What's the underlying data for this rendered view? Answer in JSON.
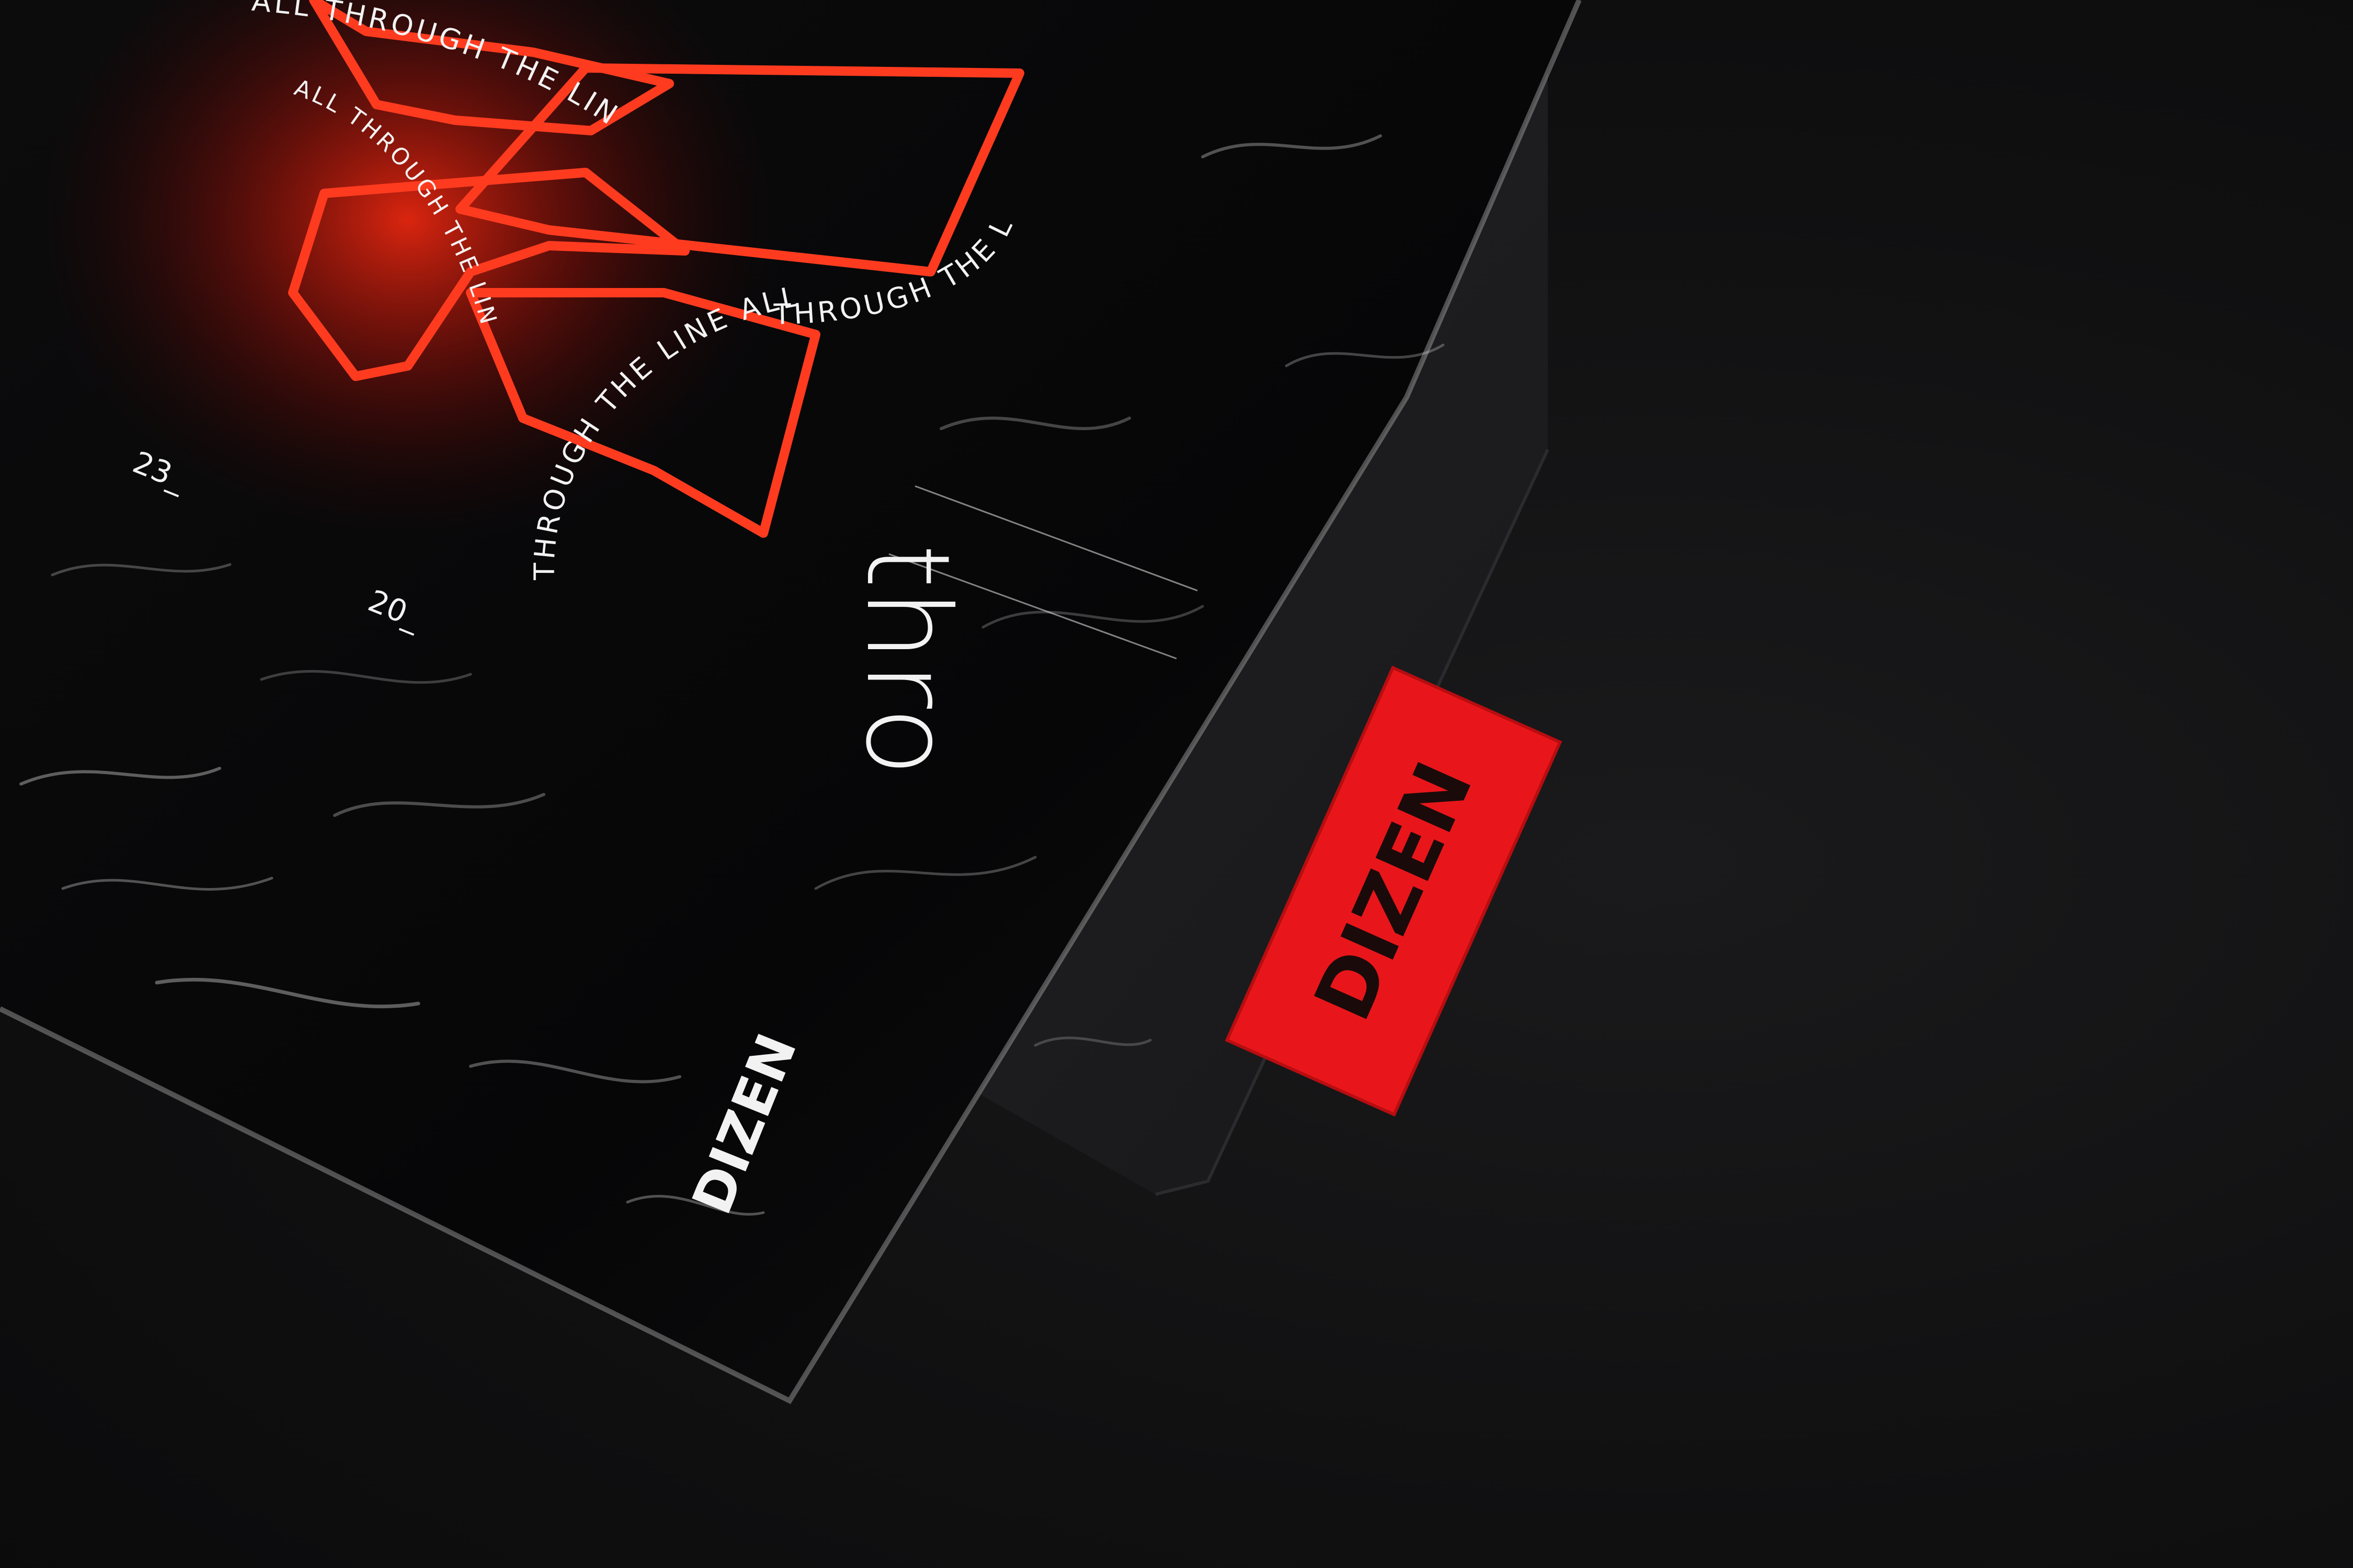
{
  "scene": {
    "description_label": "",
    "colors": {
      "background": "#101011",
      "fabric": "#1e1e20",
      "neon": "#ff3b1f",
      "label_red": "#e8161a",
      "text_white": "#f2f2f2"
    }
  },
  "bag": {
    "circular_text_outer": "ALL THROUGH THE LINE",
    "circular_text_inner": "THROUGH THE LINE ALL",
    "circular_text_spiral": "THROUGH THE LINE ALL THROUGH THE LINE ALL",
    "circular_text_small": "ALL THROUGH THE LINE ALL THROUGH",
    "number_1": "23_",
    "number_2": "20_",
    "word": "thro",
    "logo": "DIZEN"
  },
  "tag": {
    "logo": "DIZEN"
  }
}
